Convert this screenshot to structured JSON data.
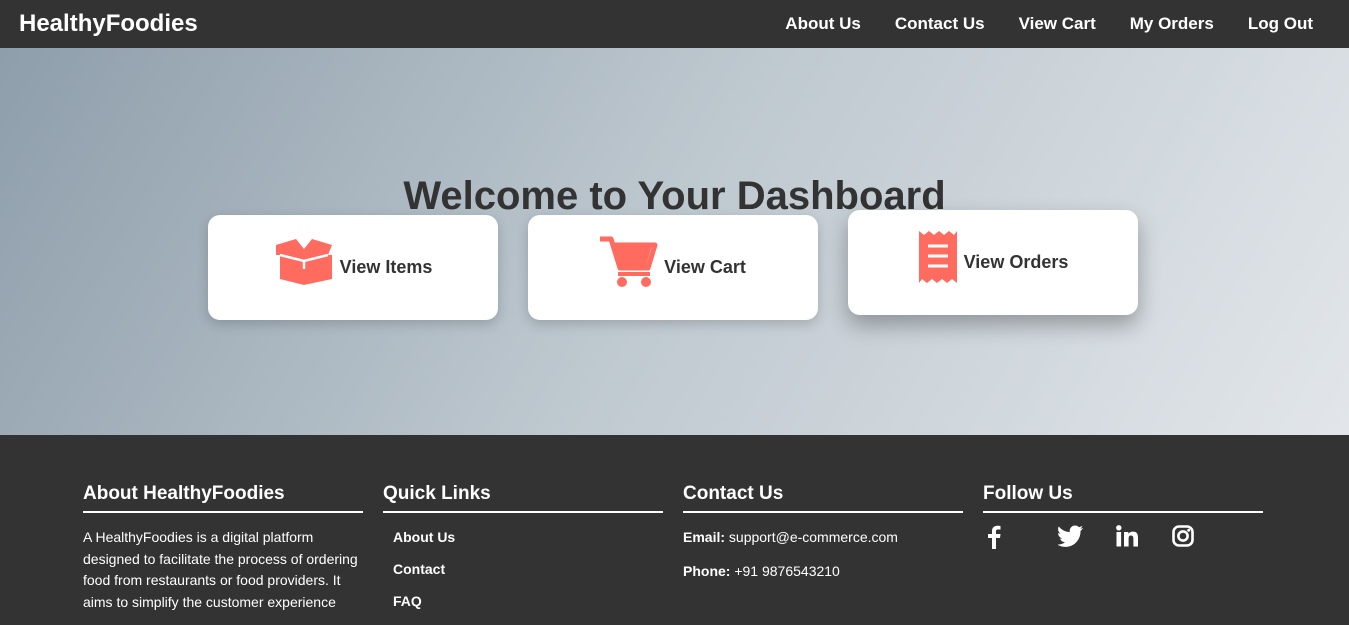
{
  "brand": "HealthyFoodies",
  "nav": {
    "links": [
      "About Us",
      "Contact Us",
      "View Cart",
      "My Orders",
      "Log Out"
    ]
  },
  "hero": {
    "title": "Welcome to Your Dashboard",
    "cards": [
      {
        "label": "View Items",
        "icon": "box-open-icon"
      },
      {
        "label": "View Cart",
        "icon": "shopping-cart-icon"
      },
      {
        "label": "View Orders",
        "icon": "receipt-icon"
      }
    ]
  },
  "colors": {
    "accent": "#ff6b5e",
    "dark": "#333333"
  },
  "footer": {
    "about": {
      "heading": "About HealthyFoodies",
      "text": "A HealthyFoodies is a digital platform designed to facilitate the process of ordering food from restaurants or food providers. It aims to simplify the customer experience"
    },
    "quick_links": {
      "heading": "Quick Links",
      "items": [
        "About Us",
        "Contact",
        "FAQ"
      ]
    },
    "contact": {
      "heading": "Contact Us",
      "email_label": "Email:",
      "email": "support@e-commerce.com",
      "phone_label": "Phone:",
      "phone": "+91 9876543210"
    },
    "follow": {
      "heading": "Follow Us",
      "icons": [
        "facebook-icon",
        "twitter-icon",
        "linkedin-icon",
        "instagram-icon"
      ]
    }
  }
}
